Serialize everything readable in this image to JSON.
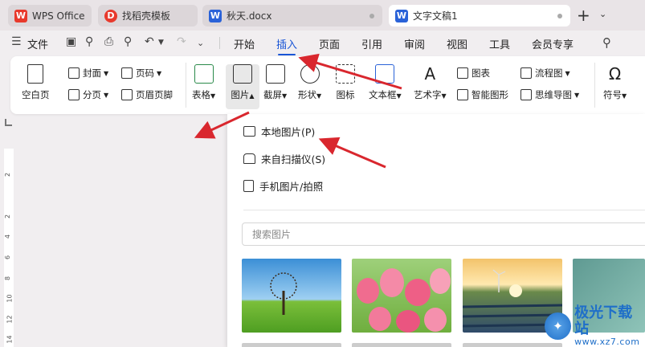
{
  "tabs": [
    {
      "label": "WPS Office",
      "logo": "W",
      "logo_color": "#e8392c"
    },
    {
      "label": "找稻壳模板",
      "logo": "D",
      "logo_color": "#e8392c"
    },
    {
      "label": "秋天.docx",
      "logo": "W",
      "logo_color": "#2a62d8"
    },
    {
      "label": "文字文稿1",
      "logo": "W",
      "logo_color": "#2a62d8"
    }
  ],
  "menu": {
    "file": "文件",
    "items": [
      "开始",
      "插入",
      "页面",
      "引用",
      "审阅",
      "视图",
      "工具",
      "会员专享"
    ],
    "selected": "插入"
  },
  "ribbon": {
    "blank_page": "空白页",
    "cover": "封面",
    "section": "分页",
    "page_number": "页码",
    "header_footer": "页眉页脚",
    "table": "表格",
    "picture": "图片",
    "screenshot": "截屏",
    "shape": "形状",
    "icon": "图标",
    "textbox": "文本框",
    "wordart": "艺术字",
    "chart": "图表",
    "smart_graphic": "智能图形",
    "flowchart": "流程图",
    "mindmap": "思维导图",
    "symbol": "符号"
  },
  "picture_menu": {
    "local_picture": "本地图片(P)",
    "from_scanner": "来自扫描仪(S)",
    "phone_picture": "手机图片/拍照",
    "search_placeholder": "搜索图片"
  },
  "ruler_numbers": [
    "2",
    "2",
    "4",
    "6",
    "8",
    "10",
    "12",
    "14"
  ],
  "watermark": {
    "line1": "极光下载站",
    "line2": "www.xz7.com"
  },
  "accent_color": "#1a56d6",
  "arrow_color": "#d9272e"
}
